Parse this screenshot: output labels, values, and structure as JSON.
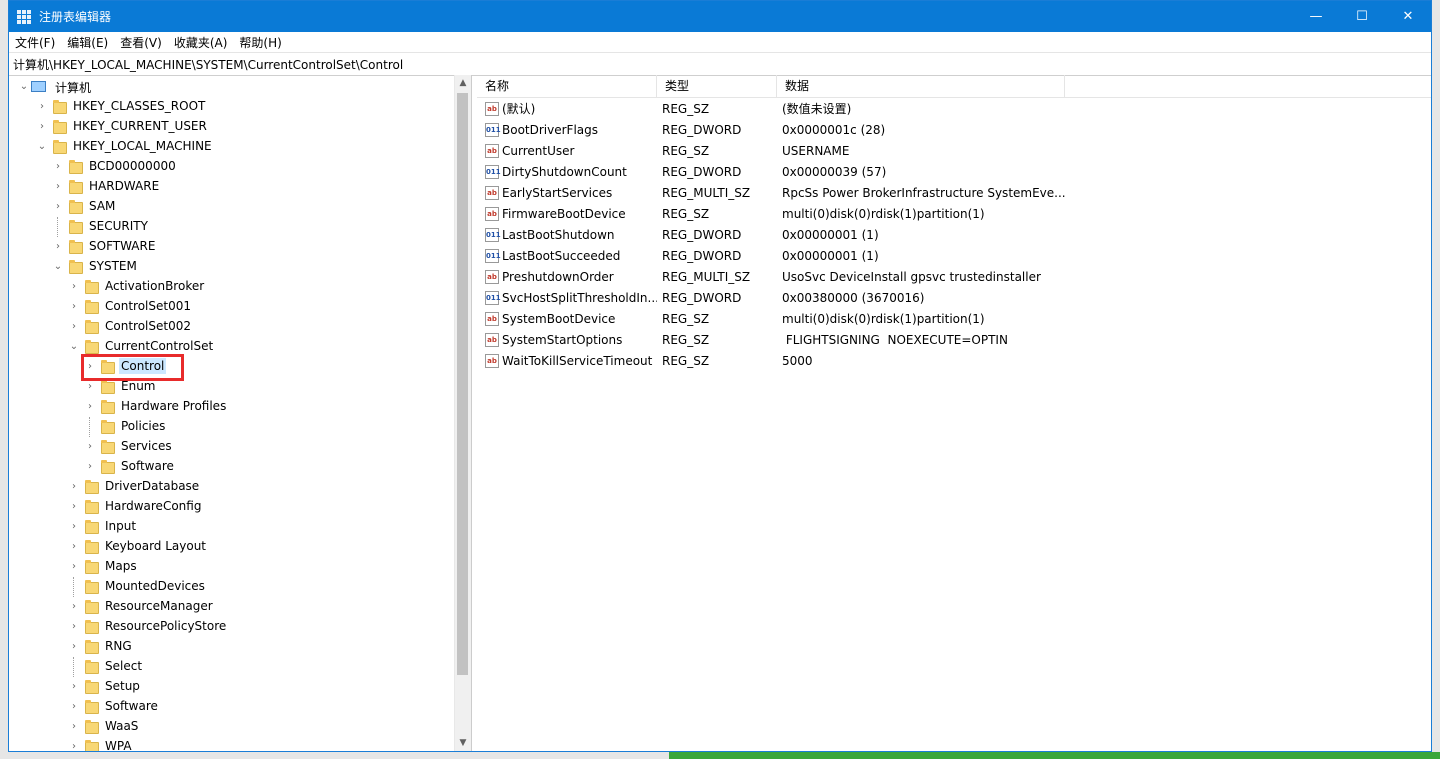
{
  "window": {
    "title": "注册表编辑器",
    "controls": {
      "minimize": "—",
      "maximize": "☐",
      "close": "✕"
    }
  },
  "menu": [
    "文件(F)",
    "编辑(E)",
    "查看(V)",
    "收藏夹(A)",
    "帮助(H)"
  ],
  "address": "计算机\\HKEY_LOCAL_MACHINE\\SYSTEM\\CurrentControlSet\\Control",
  "tree": [
    {
      "label": "计算机",
      "level": 0,
      "chev": "open",
      "icon": "computer-icon"
    },
    {
      "label": "HKEY_CLASSES_ROOT",
      "level": 1,
      "chev": "closed"
    },
    {
      "label": "HKEY_CURRENT_USER",
      "level": 1,
      "chev": "closed"
    },
    {
      "label": "HKEY_LOCAL_MACHINE",
      "level": 1,
      "chev": "open"
    },
    {
      "label": "BCD00000000",
      "level": 2,
      "chev": "closed"
    },
    {
      "label": "HARDWARE",
      "level": 2,
      "chev": "closed"
    },
    {
      "label": "SAM",
      "level": 2,
      "chev": "closed"
    },
    {
      "label": "SECURITY",
      "level": 2,
      "chev": "none"
    },
    {
      "label": "SOFTWARE",
      "level": 2,
      "chev": "closed"
    },
    {
      "label": "SYSTEM",
      "level": 2,
      "chev": "open"
    },
    {
      "label": "ActivationBroker",
      "level": 3,
      "chev": "closed"
    },
    {
      "label": "ControlSet001",
      "level": 3,
      "chev": "closed"
    },
    {
      "label": "ControlSet002",
      "level": 3,
      "chev": "closed"
    },
    {
      "label": "CurrentControlSet",
      "level": 3,
      "chev": "open"
    },
    {
      "label": "Control",
      "level": 4,
      "chev": "closed",
      "selected": true
    },
    {
      "label": "Enum",
      "level": 4,
      "chev": "closed"
    },
    {
      "label": "Hardware Profiles",
      "level": 4,
      "chev": "closed"
    },
    {
      "label": "Policies",
      "level": 4,
      "chev": "none"
    },
    {
      "label": "Services",
      "level": 4,
      "chev": "closed"
    },
    {
      "label": "Software",
      "level": 4,
      "chev": "closed"
    },
    {
      "label": "DriverDatabase",
      "level": 3,
      "chev": "closed"
    },
    {
      "label": "HardwareConfig",
      "level": 3,
      "chev": "closed"
    },
    {
      "label": "Input",
      "level": 3,
      "chev": "closed"
    },
    {
      "label": "Keyboard Layout",
      "level": 3,
      "chev": "closed"
    },
    {
      "label": "Maps",
      "level": 3,
      "chev": "closed"
    },
    {
      "label": "MountedDevices",
      "level": 3,
      "chev": "none"
    },
    {
      "label": "ResourceManager",
      "level": 3,
      "chev": "closed"
    },
    {
      "label": "ResourcePolicyStore",
      "level": 3,
      "chev": "closed"
    },
    {
      "label": "RNG",
      "level": 3,
      "chev": "closed"
    },
    {
      "label": "Select",
      "level": 3,
      "chev": "none"
    },
    {
      "label": "Setup",
      "level": 3,
      "chev": "closed"
    },
    {
      "label": "Software",
      "level": 3,
      "chev": "closed"
    },
    {
      "label": "WaaS",
      "level": 3,
      "chev": "closed"
    },
    {
      "label": "WPA",
      "level": 3,
      "chev": "closed"
    }
  ],
  "list": {
    "headers": [
      "名称",
      "类型",
      "数据"
    ],
    "rows": [
      {
        "icon": "ab",
        "name": "(默认)",
        "type": "REG_SZ",
        "data": "(数值未设置)"
      },
      {
        "icon": "bin",
        "name": "BootDriverFlags",
        "type": "REG_DWORD",
        "data": "0x0000001c (28)"
      },
      {
        "icon": "ab",
        "name": "CurrentUser",
        "type": "REG_SZ",
        "data": "USERNAME"
      },
      {
        "icon": "bin",
        "name": "DirtyShutdownCount",
        "type": "REG_DWORD",
        "data": "0x00000039 (57)"
      },
      {
        "icon": "ab",
        "name": "EarlyStartServices",
        "type": "REG_MULTI_SZ",
        "data": "RpcSs Power BrokerInfrastructure SystemEve..."
      },
      {
        "icon": "ab",
        "name": "FirmwareBootDevice",
        "type": "REG_SZ",
        "data": "multi(0)disk(0)rdisk(1)partition(1)"
      },
      {
        "icon": "bin",
        "name": "LastBootShutdown",
        "type": "REG_DWORD",
        "data": "0x00000001 (1)"
      },
      {
        "icon": "bin",
        "name": "LastBootSucceeded",
        "type": "REG_DWORD",
        "data": "0x00000001 (1)"
      },
      {
        "icon": "ab",
        "name": "PreshutdownOrder",
        "type": "REG_MULTI_SZ",
        "data": "UsoSvc DeviceInstall gpsvc trustedinstaller"
      },
      {
        "icon": "bin",
        "name": "SvcHostSplitThresholdIn...",
        "type": "REG_DWORD",
        "data": "0x00380000 (3670016)"
      },
      {
        "icon": "ab",
        "name": "SystemBootDevice",
        "type": "REG_SZ",
        "data": "multi(0)disk(0)rdisk(1)partition(1)"
      },
      {
        "icon": "ab",
        "name": "SystemStartOptions",
        "type": "REG_SZ",
        "data": " FLIGHTSIGNING  NOEXECUTE=OPTIN"
      },
      {
        "icon": "ab",
        "name": "WaitToKillServiceTimeout",
        "type": "REG_SZ",
        "data": "5000"
      }
    ]
  },
  "icon_glyphs": {
    "ab": "ab",
    "bin": "011"
  }
}
